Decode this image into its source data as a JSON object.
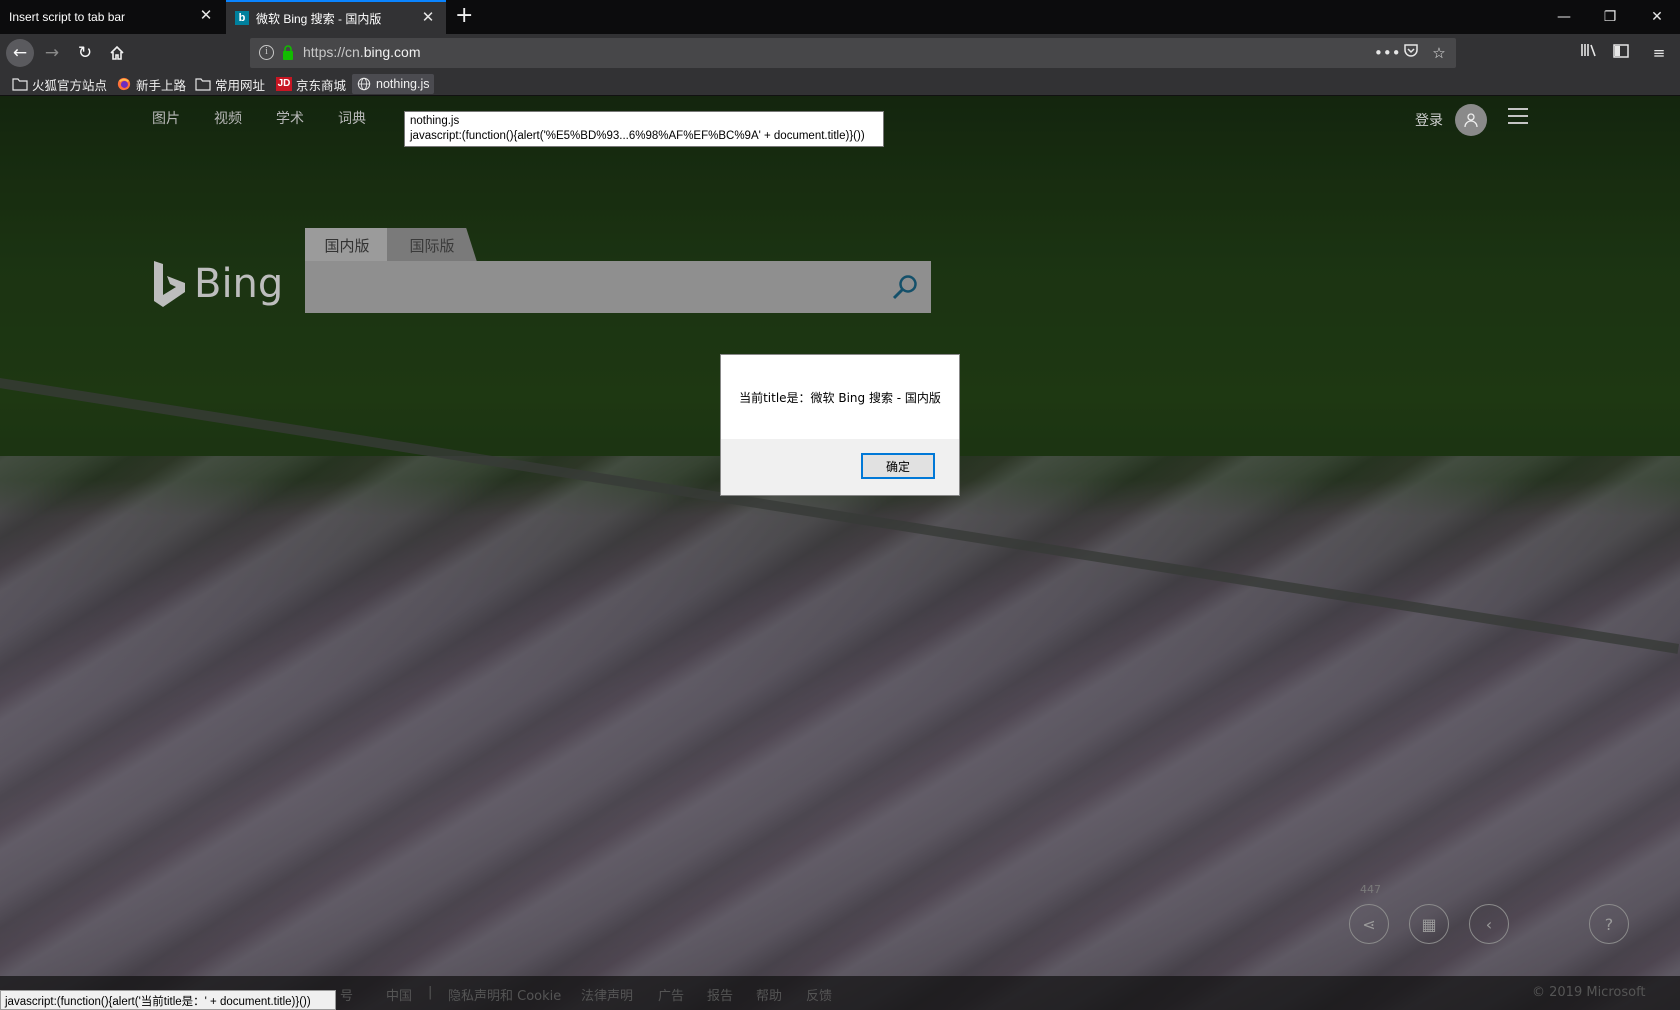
{
  "tabs": [
    {
      "title": "Insert script to tab bar",
      "close_icon": "close-icon"
    },
    {
      "title": "微软 Bing 搜索 - 国内版",
      "favicon": "b",
      "close_icon": "close-icon"
    }
  ],
  "new_tab_glyph": "+",
  "window_controls": {
    "minimize": "—",
    "restore": "❐",
    "close": "✕"
  },
  "url": {
    "prefix": "https://cn.",
    "domain": "bing.com"
  },
  "bookmarks": [
    {
      "label": "火狐官方站点",
      "icon": "folder-icon"
    },
    {
      "label": "新手上路",
      "icon": "firefox-icon"
    },
    {
      "label": "常用网址",
      "icon": "folder-icon"
    },
    {
      "label": "京东商城",
      "icon": "jd-icon",
      "icon_text": "JD"
    },
    {
      "label": "nothing.js",
      "icon": "globe-icon"
    }
  ],
  "bing": {
    "nav": [
      "图片",
      "视频",
      "学术",
      "词典"
    ],
    "login": "登录",
    "logo_text": "Bing",
    "search_tabs": [
      "国内版",
      "国际版"
    ],
    "image_count": "447",
    "footer_items": [
      "号",
      "中国",
      "|",
      "隐私声明和 Cookie",
      "法律声明",
      "广告",
      "报告",
      "帮助",
      "反馈"
    ],
    "copyright": "© 2019 Microsoft"
  },
  "tooltip": {
    "line1": "nothing.js",
    "line2": "javascript:(function(){alert('%E5%BD%93...6%98%AF%EF%BC%9A' + document.title)}())"
  },
  "dialog": {
    "message": "当前title是：微软 Bing 搜索 - 国内版",
    "ok_label": "确定"
  },
  "status_text": "javascript:(function(){alert('当前title是：' + document.title)}())",
  "colors": {
    "tab_accent": "#0a84ff",
    "bing_favicon": "#00809d",
    "lock_green": "#12bc00",
    "dialog_button_border": "#0078d7"
  }
}
